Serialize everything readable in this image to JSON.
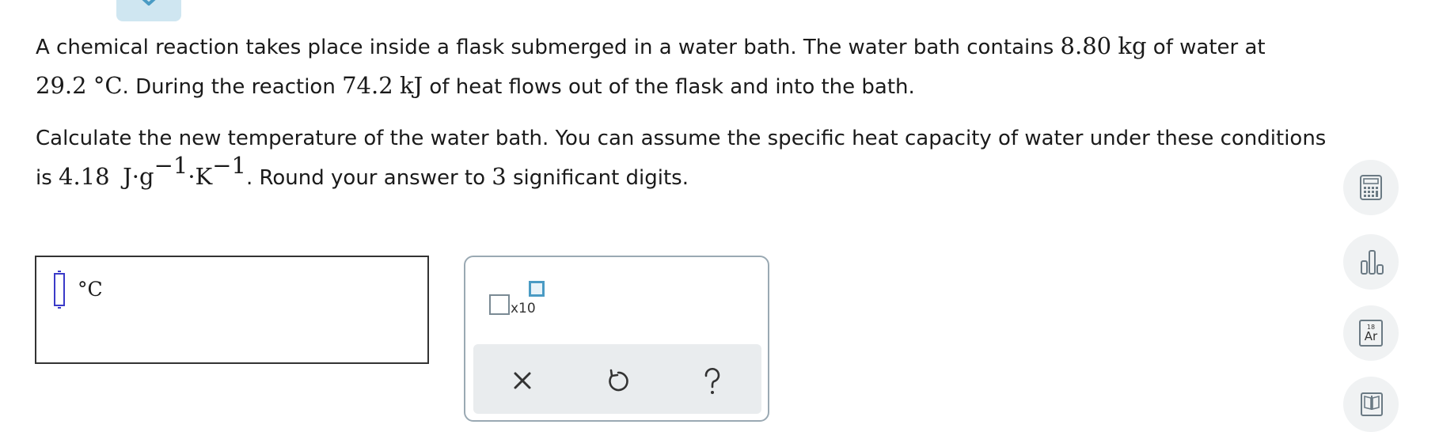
{
  "question": {
    "p1_line1_a": "A chemical reaction takes place inside a flask submerged in a water bath. The water bath contains ",
    "mass_value": "8.80",
    "mass_unit": "kg",
    "p1_line1_b": " of water at",
    "temp_value": "29.2",
    "temp_unit": "°C",
    "p1_line2_a": ". During the reaction ",
    "heat_value": "74.2",
    "heat_unit": "kJ",
    "p1_line2_b": " of heat flows out of the flask and into the bath.",
    "p2_line1": "Calculate the new temperature of the water bath. You can assume the specific heat capacity of water under these conditions",
    "p2_line2_a": "is ",
    "cp_value": "4.18",
    "cp_unit_j": "J·g",
    "cp_exp1": "−1",
    "cp_unit_k": "·K",
    "cp_exp2": "−1",
    "p2_line2_b": ". Round your answer to ",
    "sig_digits": "3",
    "p2_line2_c": " significant digits."
  },
  "answer": {
    "value": "",
    "unit": "°C"
  },
  "palette": {
    "sci_notation_label": "x10",
    "clear_icon": "x-icon",
    "undo_icon": "undo-icon",
    "help_icon": "question-icon"
  },
  "tools": {
    "calculator_icon": "calculator-icon",
    "data_icon": "bar-chart-icon",
    "periodic_number": "18",
    "periodic_symbol": "Ar",
    "reference_icon": "book-icon"
  },
  "colors": {
    "accent_blue": "#4a9bc4",
    "tab_bg": "#cfe6f1",
    "cursor_blue": "#3a3ac8"
  }
}
